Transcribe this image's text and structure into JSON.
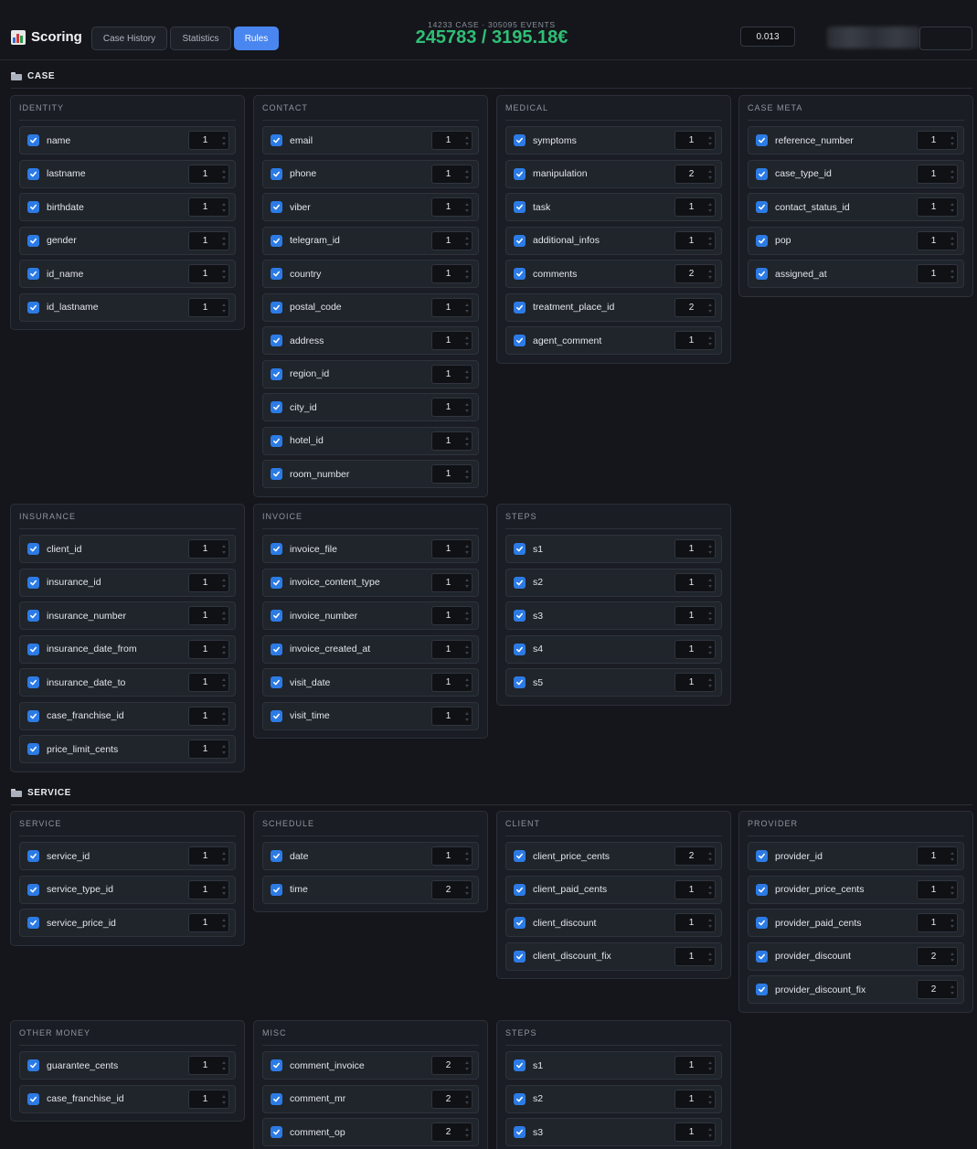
{
  "header": {
    "app_title": "Scoring",
    "tabs": [
      {
        "label": "Case History",
        "active": false
      },
      {
        "label": "Statistics",
        "active": false
      },
      {
        "label": "Rules",
        "active": true
      }
    ],
    "stats_sub": "14233 CASE · 305095 EVENTS",
    "stats_main": "245783 / 3195.18€",
    "threshold_value": "0.013"
  },
  "colors": {
    "accent": "#4a86f0",
    "checkbox": "#2c7be5",
    "stats_green": "#2fbf76",
    "background": "#14161b"
  },
  "sections": [
    {
      "title": "CASE",
      "groups": [
        {
          "title": "IDENTITY",
          "fields": [
            {
              "name": "name",
              "weight": "1",
              "checked": true
            },
            {
              "name": "lastname",
              "weight": "1",
              "checked": true
            },
            {
              "name": "birthdate",
              "weight": "1",
              "checked": true
            },
            {
              "name": "gender",
              "weight": "1",
              "checked": true
            },
            {
              "name": "id_name",
              "weight": "1",
              "checked": true
            },
            {
              "name": "id_lastname",
              "weight": "1",
              "checked": true
            }
          ]
        },
        {
          "title": "CONTACT",
          "fields": [
            {
              "name": "email",
              "weight": "1",
              "checked": true
            },
            {
              "name": "phone",
              "weight": "1",
              "checked": true
            },
            {
              "name": "viber",
              "weight": "1",
              "checked": true
            },
            {
              "name": "telegram_id",
              "weight": "1",
              "checked": true
            },
            {
              "name": "country",
              "weight": "1",
              "checked": true
            },
            {
              "name": "postal_code",
              "weight": "1",
              "checked": true
            },
            {
              "name": "address",
              "weight": "1",
              "checked": true
            },
            {
              "name": "region_id",
              "weight": "1",
              "checked": true
            },
            {
              "name": "city_id",
              "weight": "1",
              "checked": true
            },
            {
              "name": "hotel_id",
              "weight": "1",
              "checked": true
            },
            {
              "name": "room_number",
              "weight": "1",
              "checked": true
            }
          ]
        },
        {
          "title": "MEDICAL",
          "fields": [
            {
              "name": "symptoms",
              "weight": "1",
              "checked": true
            },
            {
              "name": "manipulation",
              "weight": "2",
              "checked": true
            },
            {
              "name": "task",
              "weight": "1",
              "checked": true
            },
            {
              "name": "additional_infos",
              "weight": "1",
              "checked": true
            },
            {
              "name": "comments",
              "weight": "2",
              "checked": true
            },
            {
              "name": "treatment_place_id",
              "weight": "2",
              "checked": true
            },
            {
              "name": "agent_comment",
              "weight": "1",
              "checked": true
            }
          ]
        },
        {
          "title": "CASE META",
          "fields": [
            {
              "name": "reference_number",
              "weight": "1",
              "checked": true
            },
            {
              "name": "case_type_id",
              "weight": "1",
              "checked": true
            },
            {
              "name": "contact_status_id",
              "weight": "1",
              "checked": true
            },
            {
              "name": "pop",
              "weight": "1",
              "checked": true
            },
            {
              "name": "assigned_at",
              "weight": "1",
              "checked": true
            }
          ]
        },
        {
          "title": "INSURANCE",
          "fields": [
            {
              "name": "client_id",
              "weight": "1",
              "checked": true
            },
            {
              "name": "insurance_id",
              "weight": "1",
              "checked": true
            },
            {
              "name": "insurance_number",
              "weight": "1",
              "checked": true
            },
            {
              "name": "insurance_date_from",
              "weight": "1",
              "checked": true
            },
            {
              "name": "insurance_date_to",
              "weight": "1",
              "checked": true
            },
            {
              "name": "case_franchise_id",
              "weight": "1",
              "checked": true
            },
            {
              "name": "price_limit_cents",
              "weight": "1",
              "checked": true
            }
          ]
        },
        {
          "title": "INVOICE",
          "fields": [
            {
              "name": "invoice_file",
              "weight": "1",
              "checked": true
            },
            {
              "name": "invoice_content_type",
              "weight": "1",
              "checked": true
            },
            {
              "name": "invoice_number",
              "weight": "1",
              "checked": true
            },
            {
              "name": "invoice_created_at",
              "weight": "1",
              "checked": true
            },
            {
              "name": "visit_date",
              "weight": "1",
              "checked": true
            },
            {
              "name": "visit_time",
              "weight": "1",
              "checked": true
            }
          ]
        },
        {
          "title": "STEPS",
          "fields": [
            {
              "name": "s1",
              "weight": "1",
              "checked": true
            },
            {
              "name": "s2",
              "weight": "1",
              "checked": true
            },
            {
              "name": "s3",
              "weight": "1",
              "checked": true
            },
            {
              "name": "s4",
              "weight": "1",
              "checked": true
            },
            {
              "name": "s5",
              "weight": "1",
              "checked": true
            }
          ]
        }
      ]
    },
    {
      "title": "SERVICE",
      "groups": [
        {
          "title": "SERVICE",
          "fields": [
            {
              "name": "service_id",
              "weight": "1",
              "checked": true
            },
            {
              "name": "service_type_id",
              "weight": "1",
              "checked": true
            },
            {
              "name": "service_price_id",
              "weight": "1",
              "checked": true
            }
          ]
        },
        {
          "title": "SCHEDULE",
          "fields": [
            {
              "name": "date",
              "weight": "1",
              "checked": true
            },
            {
              "name": "time",
              "weight": "2",
              "checked": true
            }
          ]
        },
        {
          "title": "CLIENT",
          "fields": [
            {
              "name": "client_price_cents",
              "weight": "2",
              "checked": true
            },
            {
              "name": "client_paid_cents",
              "weight": "1",
              "checked": true
            },
            {
              "name": "client_discount",
              "weight": "1",
              "checked": true
            },
            {
              "name": "client_discount_fix",
              "weight": "1",
              "checked": true
            }
          ]
        },
        {
          "title": "PROVIDER",
          "fields": [
            {
              "name": "provider_id",
              "weight": "1",
              "checked": true
            },
            {
              "name": "provider_price_cents",
              "weight": "1",
              "checked": true
            },
            {
              "name": "provider_paid_cents",
              "weight": "1",
              "checked": true
            },
            {
              "name": "provider_discount",
              "weight": "2",
              "checked": true
            },
            {
              "name": "provider_discount_fix",
              "weight": "2",
              "checked": true
            }
          ]
        },
        {
          "title": "OTHER MONEY",
          "fields": [
            {
              "name": "guarantee_cents",
              "weight": "1",
              "checked": true
            },
            {
              "name": "case_franchise_id",
              "weight": "1",
              "checked": true
            }
          ]
        },
        {
          "title": "MISC",
          "fields": [
            {
              "name": "comment_invoice",
              "weight": "2",
              "checked": true
            },
            {
              "name": "comment_mr",
              "weight": "2",
              "checked": true
            },
            {
              "name": "comment_op",
              "weight": "2",
              "checked": true
            }
          ]
        },
        {
          "title": "STEPS",
          "fields": [
            {
              "name": "s1",
              "weight": "1",
              "checked": true
            },
            {
              "name": "s2",
              "weight": "1",
              "checked": true
            },
            {
              "name": "s3",
              "weight": "1",
              "checked": true
            }
          ]
        }
      ]
    }
  ]
}
